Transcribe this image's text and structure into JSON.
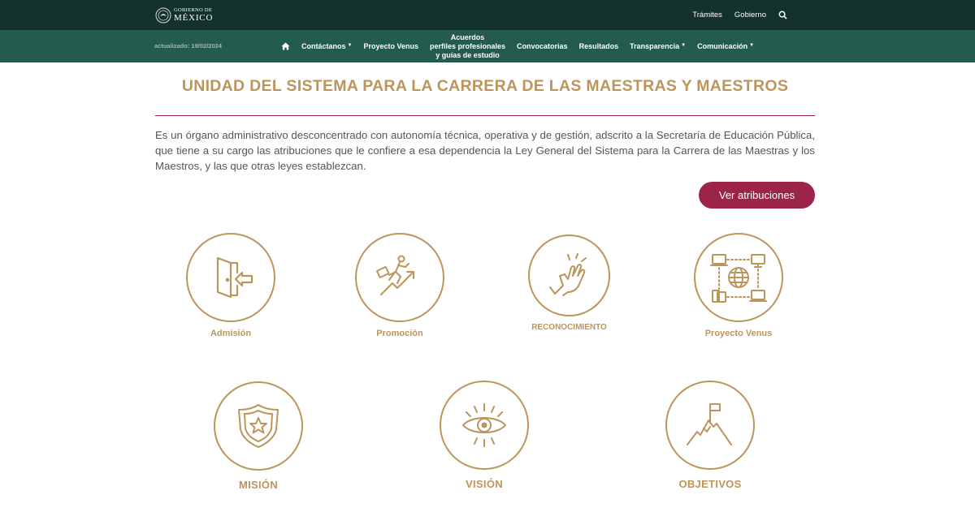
{
  "header": {
    "logo_line1": "GOBIERNO DE",
    "logo_line2": "MÉXICO",
    "links": [
      "Trámites",
      "Gobierno"
    ]
  },
  "nav": {
    "updated": "actualizado: 19/02/2024",
    "items": {
      "contactanos": "Contáctanos",
      "proyecto_venus": "Proyecto Venus",
      "acuerdos_l1": "Acuerdos",
      "acuerdos_l2": "perfiles profesionales",
      "acuerdos_l3": "y guías de estudio",
      "convocatorias": "Convocatorias",
      "resultados": "Resultados",
      "transparencia": "Transparencia",
      "comunicacion": "Comunicación"
    }
  },
  "main": {
    "title": "UNIDAD DEL SISTEMA PARA LA CARRERA DE LAS MAESTRAS Y MAESTROS",
    "description": "Es un órgano administrativo desconcentrado con autonomía técnica, operativa y de gestión, adscrito a la Secretaría de Educación Pública, que tiene a su cargo las atribuciones que le confiere a esa dependencia la Ley General del Sistema para la Carrera de las Maestras y los Maestros, y las que otras leyes establezcan.",
    "button": "Ver atribuciones"
  },
  "cards": [
    {
      "label": "Admisión",
      "icon": "door-enter-icon"
    },
    {
      "label": "Promoción",
      "icon": "climbing-arrow-icon"
    },
    {
      "label": "RECONOCIMIENTO",
      "icon": "clapping-hands-icon"
    },
    {
      "label": "Proyecto Venus",
      "icon": "network-globe-icon"
    },
    {
      "label": "MISIÓN",
      "icon": "shield-star-icon"
    },
    {
      "label": "VISIÓN",
      "icon": "eye-icon"
    },
    {
      "label": "OBJETIVOS",
      "icon": "mountain-flag-icon"
    }
  ],
  "colors": {
    "topbar": "#13322b",
    "navbar": "#235b4e",
    "gold": "#bc955c",
    "accent": "#9d2449"
  }
}
